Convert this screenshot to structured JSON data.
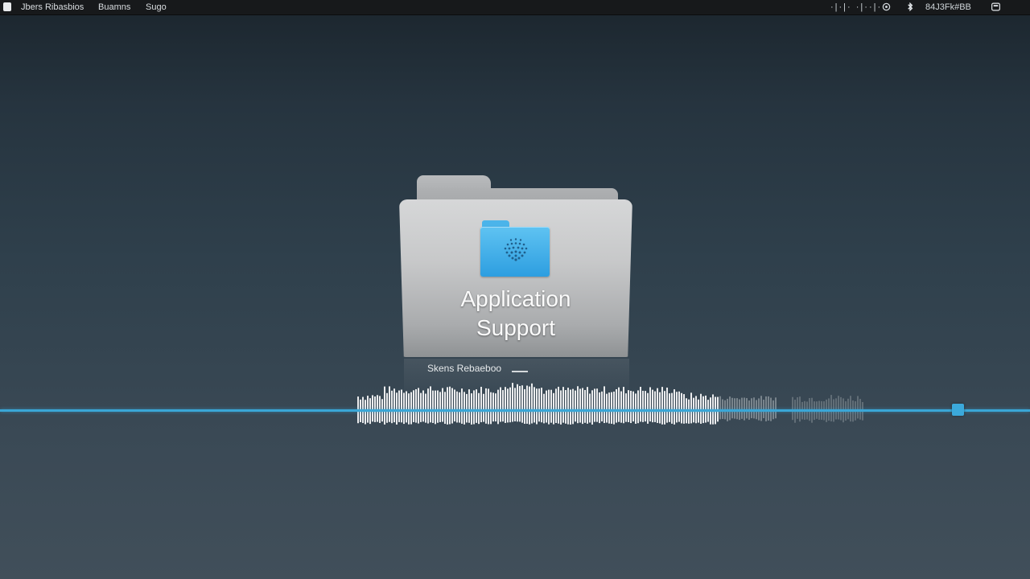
{
  "menubar": {
    "items": [
      "Jbers Ribasbios",
      "Buamns",
      "Sugo"
    ],
    "status_left": "·|·|· ·|··|·",
    "clock": "84J3Fk#BB"
  },
  "folder": {
    "label_line1": "Application",
    "label_line2": "Support",
    "caption": "Skens Rebaeboo"
  },
  "progress": {
    "value": 0.93
  },
  "colors": {
    "accent": "#3aa6d6",
    "menubar": "#17191b",
    "folder_blue": "#2d9ee0"
  },
  "icons": [
    "apple-icon",
    "wifi-icon",
    "bluetooth-icon",
    "notification-icon",
    "folder-icon"
  ]
}
